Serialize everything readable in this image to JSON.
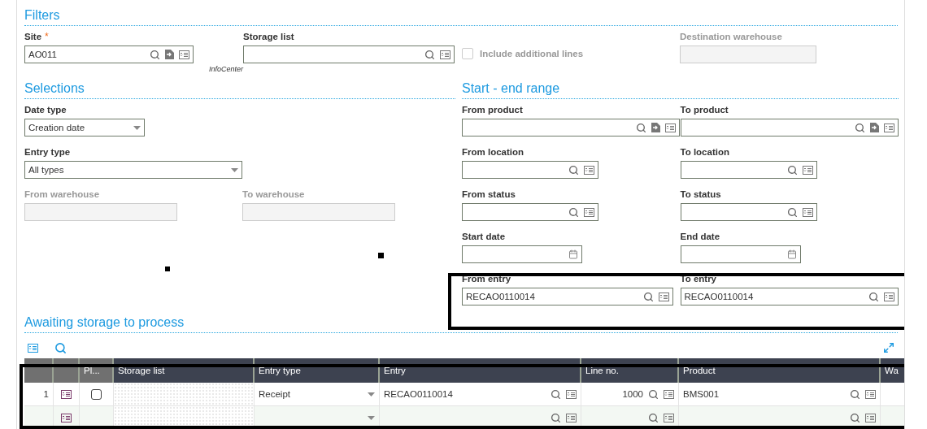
{
  "filters": {
    "title": "Filters",
    "fields": [
      {
        "label": "Site",
        "required_mark": "*",
        "kind": "lookup_jump",
        "value": "AO011",
        "caption": "InfoCenter"
      },
      {
        "label": "Storage list",
        "kind": "lookup"
      },
      {
        "label": "Include additional lines",
        "kind": "checkbox",
        "checked": false,
        "disabled": true
      },
      {
        "label": "Destination warehouse",
        "kind": "plain",
        "disabled": true
      }
    ]
  },
  "selections": {
    "title": "Selections",
    "rows": [
      [
        {
          "label": "Date type",
          "kind": "select",
          "value": "Creation date"
        }
      ],
      [
        {
          "label": "Entry type",
          "kind": "select",
          "value": "All types"
        }
      ],
      [
        {
          "label": "From warehouse",
          "kind": "plain",
          "disabled": true
        },
        {
          "label": "To warehouse",
          "kind": "plain",
          "disabled": true
        }
      ]
    ]
  },
  "range": {
    "title": "Start - end range",
    "rows": [
      [
        {
          "label": "From product",
          "kind": "lookup_jump"
        },
        {
          "label": "To product",
          "kind": "lookup_jump"
        }
      ],
      [
        {
          "label": "From location",
          "kind": "lookup"
        },
        {
          "label": "To location",
          "kind": "lookup"
        }
      ],
      [
        {
          "label": "From status",
          "kind": "lookup"
        },
        {
          "label": "To status",
          "kind": "lookup"
        }
      ],
      [
        {
          "label": "Start date",
          "kind": "date"
        },
        {
          "label": "End date",
          "kind": "date"
        }
      ],
      [
        {
          "label": "From entry",
          "kind": "lookup",
          "value": "RECAO0110014"
        },
        {
          "label": "To entry",
          "kind": "lookup",
          "value": "RECAO0110014"
        }
      ]
    ]
  },
  "table": {
    "title": "Awaiting storage to process",
    "columns": [
      "",
      "",
      "Pl...",
      "Storage list",
      "Entry type",
      "Entry",
      "Line no.",
      "Product",
      "Wa"
    ],
    "rows": [
      {
        "number": "1",
        "checked": false,
        "entry_type": "Receipt",
        "entry": "RECAO0110014",
        "line_no": "1000",
        "product": "BMS001"
      }
    ]
  }
}
